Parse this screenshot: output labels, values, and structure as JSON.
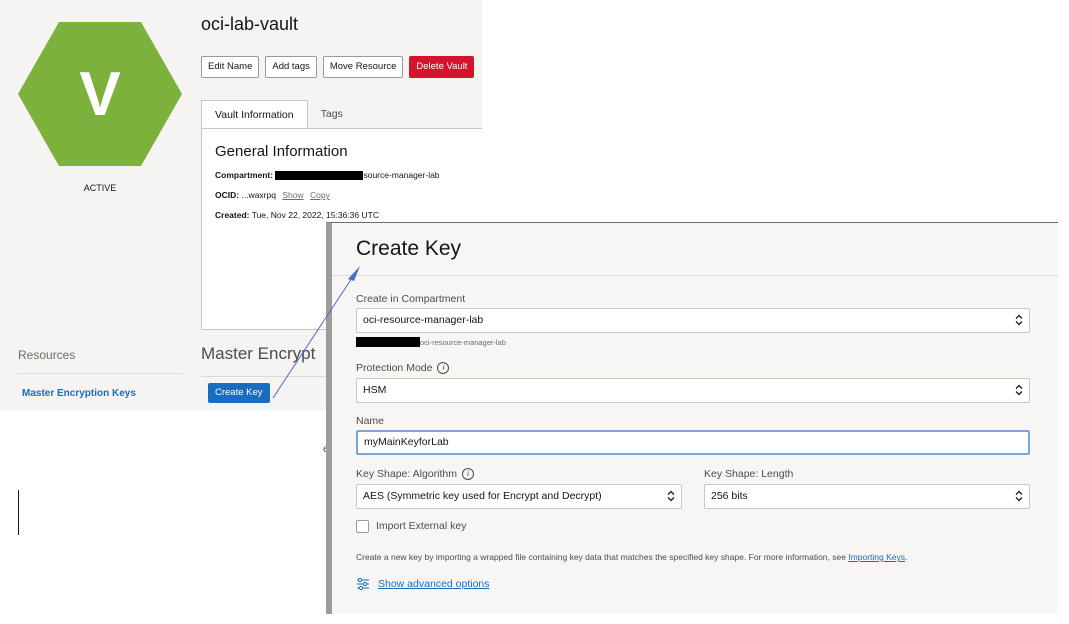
{
  "vault": {
    "icon_letter": "V",
    "status": "ACTIVE",
    "title": "oci-lab-vault",
    "buttons": {
      "edit_name": "Edit Name",
      "add_tags": "Add tags",
      "move_resource": "Move Resource",
      "delete_vault": "Delete Vault"
    },
    "tabs": [
      "Vault Information",
      "Tags"
    ],
    "general_info_title": "General Information",
    "compartment_label": "Compartment:",
    "compartment_value": "source-manager-lab",
    "ocid_label": "OCID:",
    "ocid_value": "...waxrpq",
    "ocid_show": "Show",
    "ocid_copy": "Copy",
    "created_label": "Created:",
    "created_value": "Tue, Nov 22, 2022, 15:36:36 UTC",
    "resources_title": "Resources",
    "resources_link": "Master Encryption Keys",
    "mek_title": "Master Encrypt",
    "create_key_button": "Create Key",
    "partial_char": "e"
  },
  "create_key": {
    "title": "Create Key",
    "compartment_label": "Create in Compartment",
    "compartment_value": "oci-resource-manager-lab",
    "compartment_path": "oci-resource-manager-lab",
    "protection_mode_label": "Protection Mode",
    "protection_mode_value": "HSM",
    "name_label": "Name",
    "name_value": "myMainKeyforLab",
    "algorithm_label": "Key Shape: Algorithm",
    "algorithm_value": "AES (Symmetric key used for Encrypt and Decrypt)",
    "length_label": "Key Shape: Length",
    "length_value": "256 bits",
    "import_label": "Import External key",
    "import_checked": false,
    "help_text": "Create a new key by importing a wrapped file containing key data that matches the specified key shape. For more information, see ",
    "help_link": "Importing Keys",
    "help_suffix": ".",
    "advanced_link": "Show advanced options"
  },
  "colors": {
    "vault_icon": "#7cb13b",
    "danger": "#d4142b",
    "link": "#1a6cc0",
    "primary_button": "#1a6cc0"
  },
  "icons": [
    "info-icon",
    "chevron-updown-icon",
    "sliders-icon",
    "annotation-arrow"
  ]
}
